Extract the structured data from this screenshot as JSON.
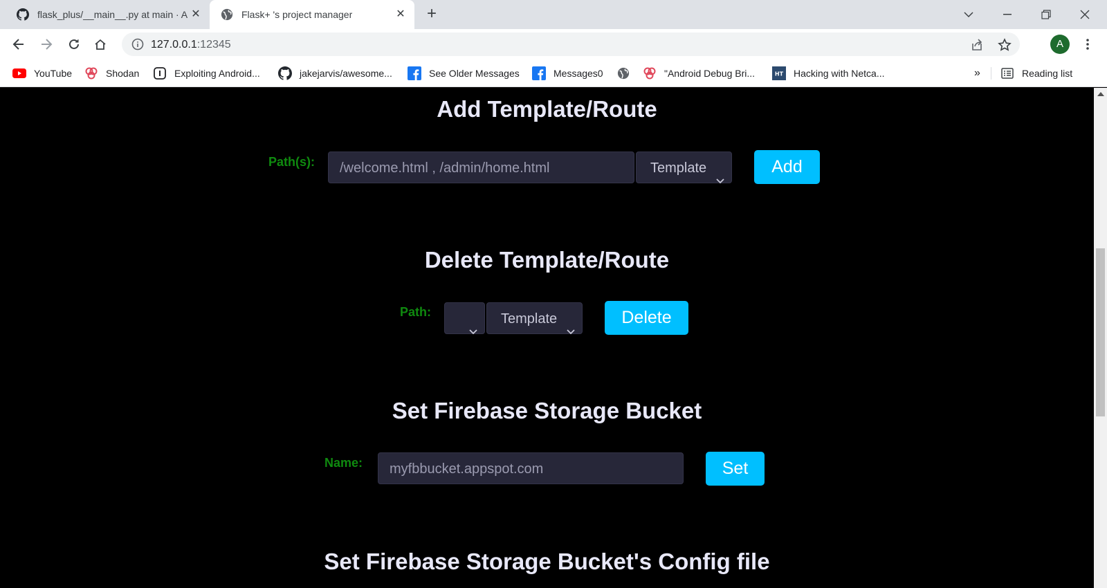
{
  "browser": {
    "tabs": [
      {
        "title": "flask_plus/__main__.py at main · A",
        "favicon": "github-icon",
        "active": false
      },
      {
        "title": "Flask+ 's project manager",
        "favicon": "globe-icon",
        "active": true
      }
    ],
    "url_host": "127.0.0.1",
    "url_port": ":12345",
    "avatar_letter": "A",
    "bookmarks": [
      {
        "label": "YouTube",
        "icon": "youtube-icon"
      },
      {
        "label": "Shodan",
        "icon": "shodan-icon"
      },
      {
        "label": "Exploiting Android...",
        "icon": "page-icon"
      },
      {
        "label": "jakejarvis/awesome...",
        "icon": "github-icon"
      },
      {
        "label": "See Older Messages",
        "icon": "facebook-icon"
      },
      {
        "label": "Messages0",
        "icon": "facebook-icon"
      },
      {
        "label": "",
        "icon": "globe-icon"
      },
      {
        "label": "\"Android Debug Bri...",
        "icon": "shodan-icon"
      },
      {
        "label": "Hacking with Netca...",
        "icon": "ht-icon"
      }
    ],
    "overflow": "»",
    "reading_list": "Reading list"
  },
  "sections": {
    "add": {
      "title": "Add Template/Route",
      "label": "Path(s):",
      "placeholder": "/welcome.html , /admin/home.html",
      "type_value": "Template",
      "button": "Add"
    },
    "delete": {
      "title": "Delete Template/Route",
      "label": "Path:",
      "path_value": "",
      "type_value": "Template",
      "button": "Delete"
    },
    "bucket": {
      "title": "Set Firebase Storage Bucket",
      "label": "Name:",
      "placeholder": "myfbbucket.appspot.com",
      "button": "Set"
    },
    "config": {
      "title": "Set Firebase Storage Bucket's Config file"
    }
  },
  "colors": {
    "page_bg": "#000000",
    "heading": "#e8e8f8",
    "label": "#0f8a0f",
    "field_bg": "#272739",
    "button": "#00bfff"
  }
}
